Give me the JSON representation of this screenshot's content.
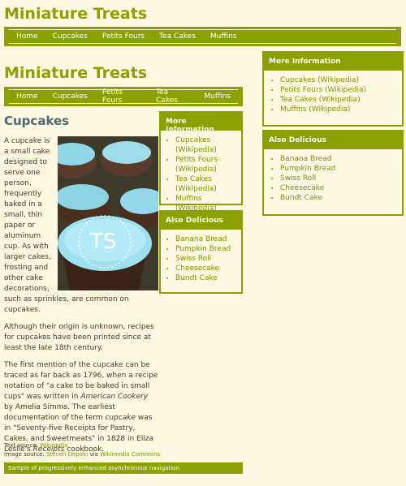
{
  "site_title": "Miniature Treats",
  "nav": [
    "Home",
    "Cupcakes",
    "Petits Fours",
    "Tea Cakes",
    "Muffins"
  ],
  "article": {
    "heading": "Cupcakes",
    "p1": "A cupcake is a small cake designed to serve one person, frequently baked in a small, thin paper or aluminum cup. As with larger cakes, frosting and other cake decorations, such as sprinkles, are common on cupcakes.",
    "p2": "Although their origin is unknown, recipes for cupcakes have been printed since at least the late 18th century.",
    "p3a": "The first mention of the cupcake can be traced as far back as 1796, when a recipe notation of \"a cake to be baked in small cups\" was written in ",
    "p3b": "American Cookery",
    "p3c": " by Amelia Simms. The earliest documentation of the term ",
    "p3d": "cupcake",
    "p3e": " was in \"Seventy-five Receipts for Pastry, Cakes, and Sweetmeats\" in 1828 in Eliza Leslie's ",
    "p3f": "Receipts",
    "p3g": " cookbook."
  },
  "credits": {
    "text_label": "Text source: ",
    "text_link": "Wikipedia",
    "image_label": "Image source: ",
    "image_link": "Steven Depolo",
    "image_via": " via ",
    "image_link2": "Wikimedia Commons"
  },
  "footer": "Sample of progressively enhanced asynchronous navigation",
  "more_info": {
    "heading": "More Information",
    "items_outer": [
      "Cupcakes (Wikipedia)",
      "Petits Fours (Wikipedia)",
      "Tea Cakes (Wikipedia)",
      "Muffins (Wikipedia)"
    ],
    "items_inner": [
      "Cupcakes (Wikipedia)",
      "Petits Fours (Wikipedia)",
      "Tea Cakes (Wikipedia)",
      "Muffins (Wikipedia)"
    ]
  },
  "also": {
    "heading": "Also Delicious",
    "items": [
      "Banana Bread",
      "Pumpkin Bread",
      "Swiss Roll",
      "Cheesecake",
      "Bundt Cake"
    ]
  }
}
